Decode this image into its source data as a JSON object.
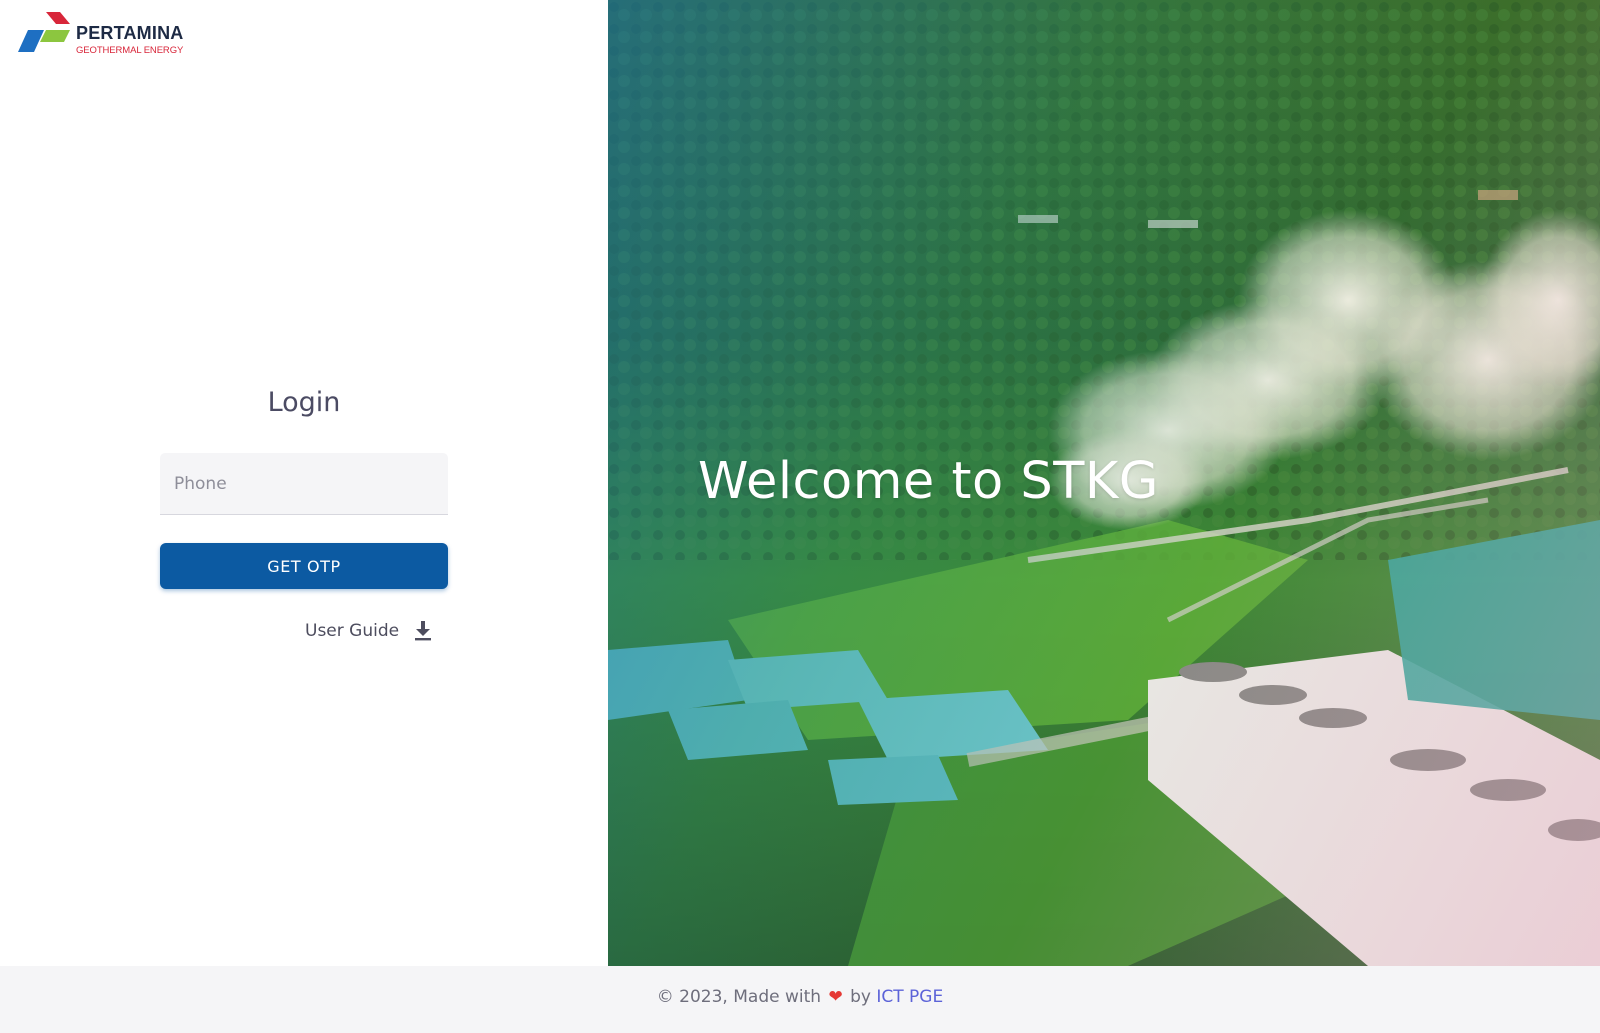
{
  "brand": {
    "name": "PERTAMINA",
    "subtitle": "GEOTHERMAL ENERGY",
    "colors": {
      "red": "#d8263a",
      "blue": "#1e6fc2",
      "green": "#8cc63f"
    }
  },
  "login": {
    "title": "Login",
    "phone_placeholder": "Phone",
    "phone_value": "",
    "otp_button_label": "GET OTP",
    "user_guide_label": "User Guide",
    "user_guide_icon": "download-icon",
    "button_color": "#0c5aa2"
  },
  "hero": {
    "title": "Welcome to STKG"
  },
  "footer": {
    "prefix": "© 2023, Made with",
    "heart": "❤",
    "by": "by",
    "link_text": "ICT PGE",
    "link_color": "#5c63d8"
  }
}
